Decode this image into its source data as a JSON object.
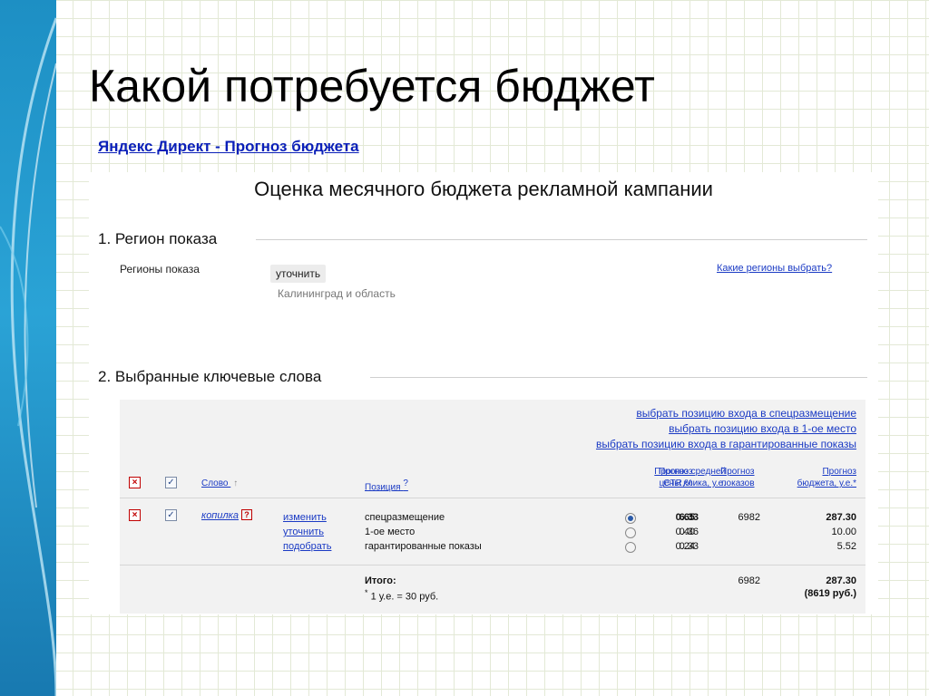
{
  "slide": {
    "title": "Какой потребуется бюджет",
    "link": "Яндекс Директ - Прогноз бюджета"
  },
  "panel": {
    "title": "Оценка месячного бюджета рекламной кампании",
    "section1": {
      "heading": "1. Регион показа",
      "label": "Регионы показа",
      "refine_button": "уточнить",
      "region": "Калининград и область",
      "help_link": "Какие регионы выбрать?"
    },
    "section2": {
      "heading": "2. Выбранные ключевые слова"
    }
  },
  "table": {
    "position_links": [
      "выбрать позицию входа в спецразмещение",
      "выбрать позицию входа в 1-ое место",
      "выбрать позицию входа в гарантированные показы"
    ],
    "headers": {
      "word": "Слово",
      "sort_arrow": "↑",
      "position": "Позиция",
      "position_help": "?",
      "avg_price_line1": "Прогноз средней",
      "avg_price_line2": "цены клика, у.е.",
      "ctr_line1": "Прогноз",
      "ctr_line2": "CTR,%",
      "shows_line1": "Прогноз",
      "shows_line2": "показов",
      "budget_line1": "Прогноз",
      "budget_line2": "бюджета, у.е.*"
    },
    "row": {
      "keyword": "копилка",
      "keyword_help": "?",
      "actions": [
        "изменить",
        "уточнить",
        "подобрать"
      ],
      "positions": [
        "спецразмещение",
        "1-ое место",
        "гарантированные показы"
      ],
      "prices": [
        "0.65",
        "0.40",
        "0.24"
      ],
      "ctr": [
        "6.33",
        "0.36",
        "0.33"
      ],
      "shows": "6982",
      "budget": [
        "287.30",
        "10.00",
        "5.52"
      ],
      "selected_position": 0
    },
    "total": {
      "label": "Итого:",
      "footnote_mark": "*",
      "footnote": "1 у.е. = 30 руб.",
      "shows": "6982",
      "budget": "287.30",
      "budget_rub": "(8619 руб.)"
    }
  },
  "icons": {
    "remove": "×",
    "checked": "✓"
  },
  "colors": {
    "link": "#1a3ac4",
    "title_link": "#0a1fb8",
    "remove_icon": "#c00000",
    "band": "#1d8fc4"
  }
}
